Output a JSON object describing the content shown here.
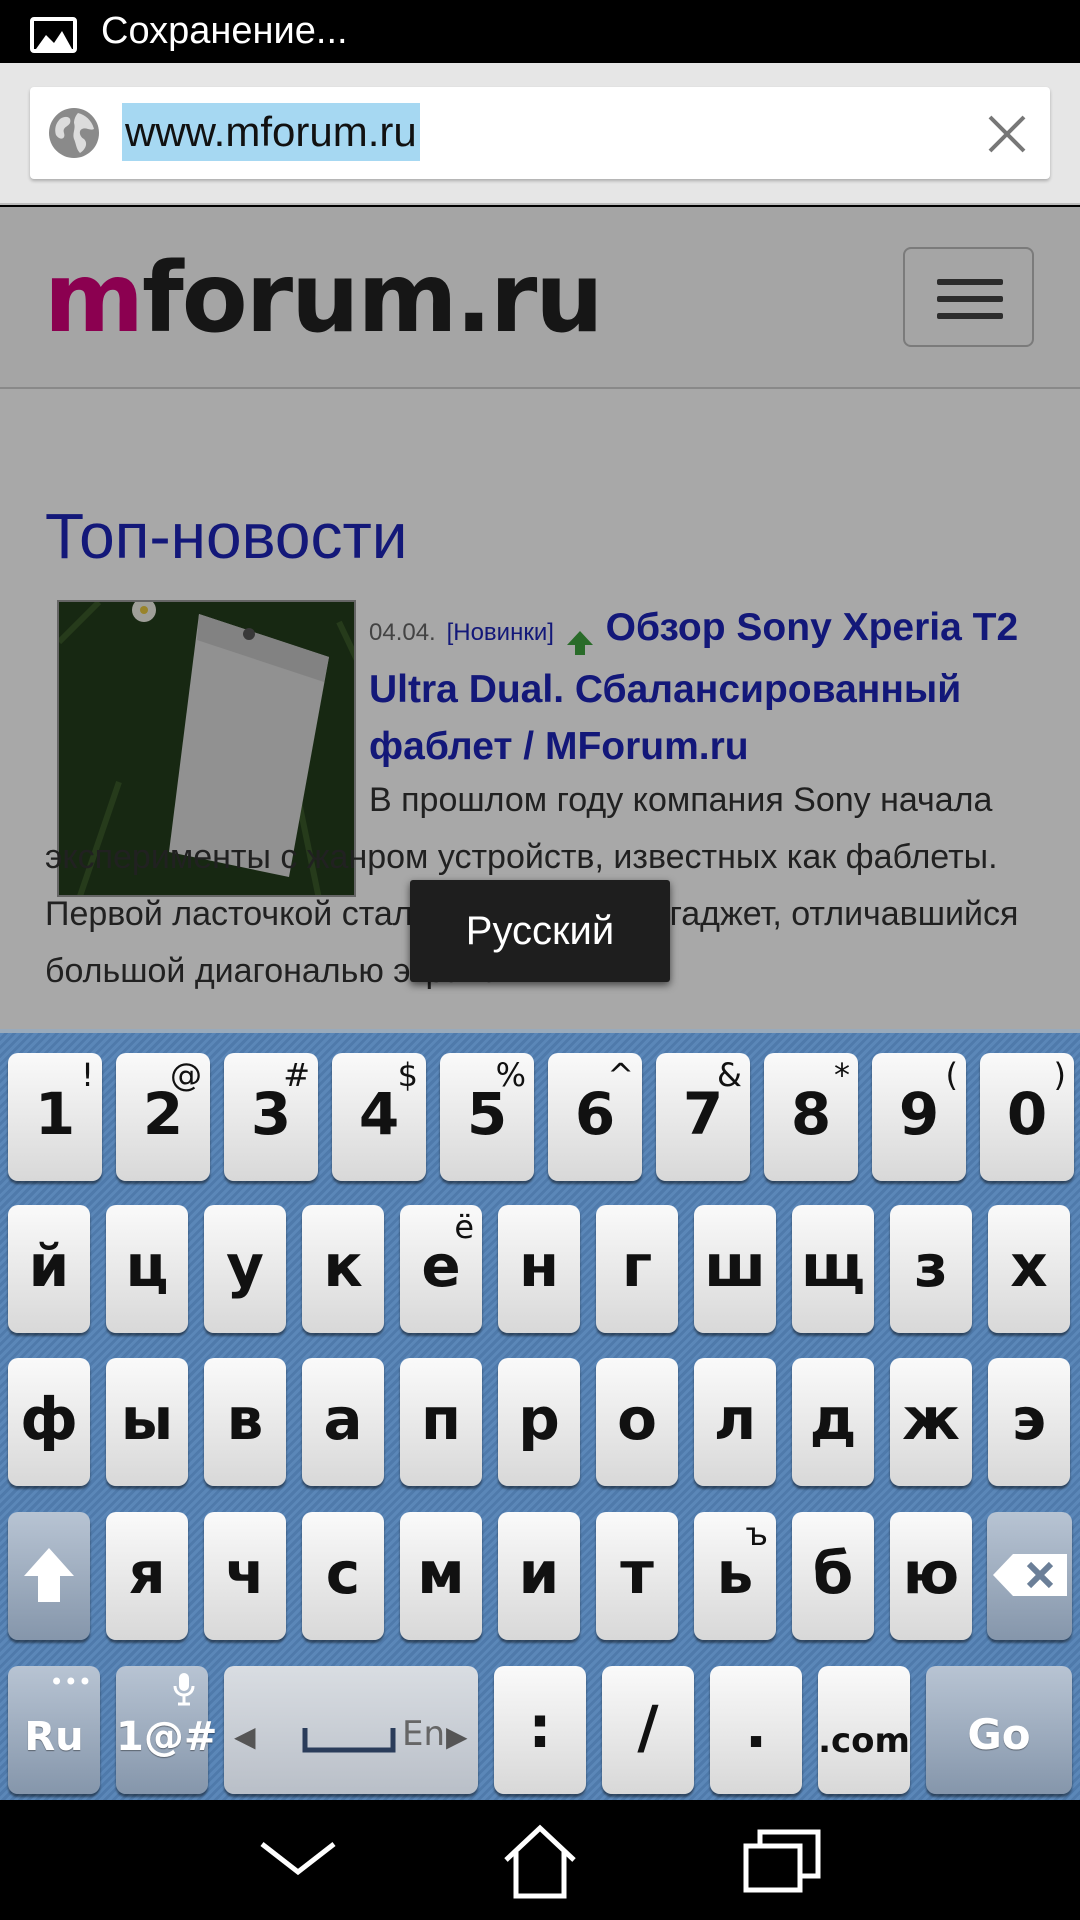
{
  "status": {
    "text": "Сохранение..."
  },
  "urlbar": {
    "url": "www.mforum.ru"
  },
  "site": {
    "logo_m": "m",
    "logo_rest": "forum.ru",
    "section_title": "Топ-новости",
    "news": {
      "date": "04.04.",
      "category": "[Новинки]",
      "title": "Обзор Sony Xperia T2 Ultra Dual. Сбалансированный фаблет / MForum.ru",
      "body": "В прошлом году компания Sony начала эксперименты с жанром устройств, известных как фаблеты. Первой ласточкой стал Xperia Z Ultra – гаджет, отличавшийся большой диагональю экрана"
    }
  },
  "tooltip": {
    "text": "Русский"
  },
  "keyboard": {
    "row1": [
      {
        "k": "1",
        "a": "!"
      },
      {
        "k": "2",
        "a": "@"
      },
      {
        "k": "3",
        "a": "#"
      },
      {
        "k": "4",
        "a": "$"
      },
      {
        "k": "5",
        "a": "%"
      },
      {
        "k": "6",
        "a": "^"
      },
      {
        "k": "7",
        "a": "&"
      },
      {
        "k": "8",
        "a": "*"
      },
      {
        "k": "9",
        "a": "("
      },
      {
        "k": "0",
        "a": ")"
      }
    ],
    "row2": [
      {
        "k": "й",
        "a": ""
      },
      {
        "k": "ц",
        "a": ""
      },
      {
        "k": "у",
        "a": ""
      },
      {
        "k": "к",
        "a": ""
      },
      {
        "k": "е",
        "a": "ё"
      },
      {
        "k": "н",
        "a": ""
      },
      {
        "k": "г",
        "a": ""
      },
      {
        "k": "ш",
        "a": ""
      },
      {
        "k": "щ",
        "a": ""
      },
      {
        "k": "з",
        "a": ""
      },
      {
        "k": "х",
        "a": ""
      }
    ],
    "row3": [
      {
        "k": "ф",
        "a": ""
      },
      {
        "k": "ы",
        "a": ""
      },
      {
        "k": "в",
        "a": ""
      },
      {
        "k": "а",
        "a": ""
      },
      {
        "k": "п",
        "a": ""
      },
      {
        "k": "р",
        "a": ""
      },
      {
        "k": "о",
        "a": ""
      },
      {
        "k": "л",
        "a": ""
      },
      {
        "k": "д",
        "a": ""
      },
      {
        "k": "ж",
        "a": ""
      },
      {
        "k": "э",
        "a": ""
      }
    ],
    "row4": [
      {
        "k": "я",
        "a": ""
      },
      {
        "k": "ч",
        "a": ""
      },
      {
        "k": "с",
        "a": ""
      },
      {
        "k": "м",
        "a": ""
      },
      {
        "k": "и",
        "a": ""
      },
      {
        "k": "т",
        "a": ""
      },
      {
        "k": "ь",
        "a": "ъ"
      },
      {
        "k": "б",
        "a": ""
      },
      {
        "k": "ю",
        "a": ""
      }
    ],
    "lang_key": "Ru",
    "lang_key_alt": "•••",
    "symbols_key": "1@#",
    "space_lang": "En",
    "colon": ":",
    "slash": "/",
    "dot": ".",
    "dotcom": ".com",
    "go": "Go"
  },
  "navbar": {
    "icons": [
      "back-icon",
      "home-icon",
      "recent-apps-icon"
    ]
  }
}
